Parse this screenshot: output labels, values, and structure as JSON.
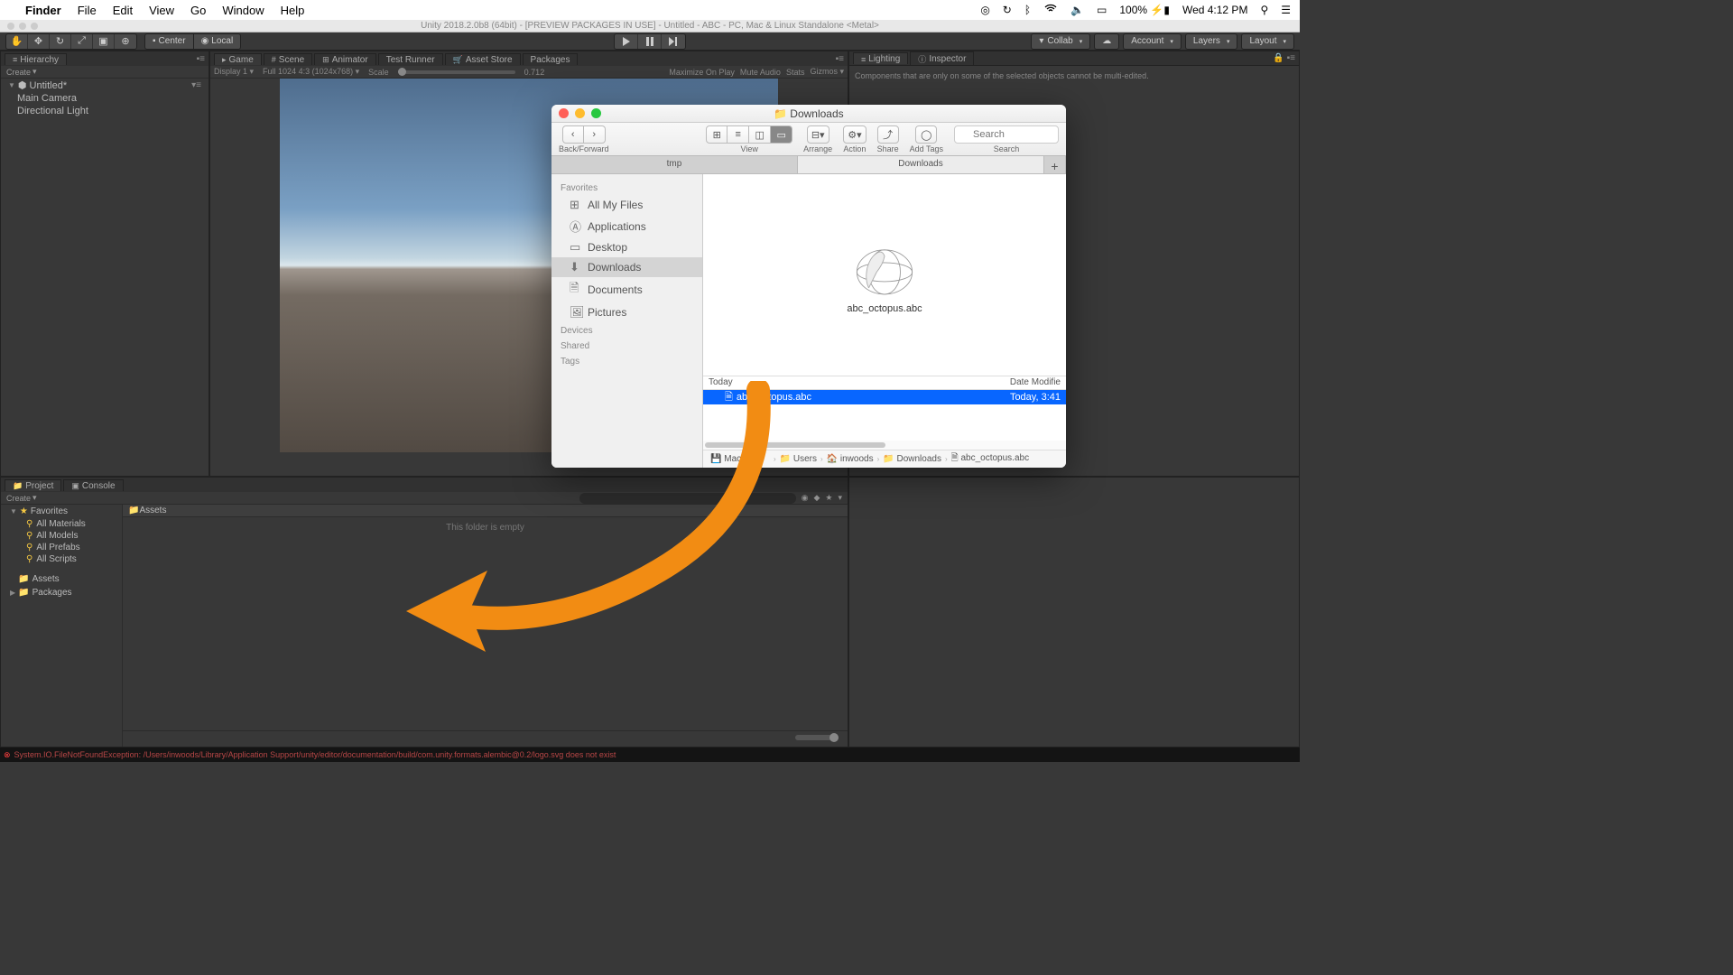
{
  "mac_menubar": {
    "app": "Finder",
    "items": [
      "File",
      "Edit",
      "View",
      "Go",
      "Window",
      "Help"
    ],
    "battery": "100%",
    "clock": "Wed 4:12 PM"
  },
  "unity_title": "Unity 2018.2.0b8 (64bit) - [PREVIEW PACKAGES IN USE] - Untitled - ABC - PC, Mac & Linux Standalone <Metal>",
  "toolbar": {
    "pivot1": "Center",
    "pivot2": "Local",
    "collab": "Collab",
    "account": "Account",
    "layers": "Layers",
    "layout": "Layout"
  },
  "hierarchy": {
    "tab": "Hierarchy",
    "create": "Create",
    "scene": "Untitled*",
    "items": [
      "Main Camera",
      "Directional Light"
    ]
  },
  "center_tabs": [
    "Game",
    "Scene",
    "Animator",
    "Test Runner",
    "Asset Store",
    "Packages"
  ],
  "game_bar": {
    "display": "Display 1",
    "aspect": "Full 1024 4:3 (1024x768)",
    "scale_label": "Scale",
    "scale_value": "0.712",
    "right": [
      "Maximize On Play",
      "Mute Audio",
      "Stats",
      "Gizmos"
    ]
  },
  "lighting": {
    "tab": "Lighting"
  },
  "inspector": {
    "tab": "Inspector",
    "message": "Components that are only on some of the selected objects cannot be multi-edited."
  },
  "project": {
    "tab": "Project",
    "console_tab": "Console",
    "create": "Create",
    "favorites": "Favorites",
    "fav_items": [
      "All Materials",
      "All Models",
      "All Prefabs",
      "All Scripts"
    ],
    "assets": "Assets",
    "packages": "Packages",
    "path": "Assets",
    "empty": "This folder is empty"
  },
  "error": "System.IO.FileNotFoundException: /Users/inwoods/Library/Application Support/unity/editor/documentation/build/com.unity.formats.alembic@0.2/logo.svg does not exist",
  "finder": {
    "title": "Downloads",
    "toolbar": {
      "back": "Back/Forward",
      "view": "View",
      "arrange": "Arrange",
      "action": "Action",
      "share": "Share",
      "tags": "Add Tags",
      "search": "Search",
      "search_placeholder": "Search"
    },
    "tabs": [
      "tmp",
      "Downloads"
    ],
    "sidebar": {
      "favorites": "Favorites",
      "items": [
        "All My Files",
        "Applications",
        "Desktop",
        "Downloads",
        "Documents",
        "Pictures"
      ],
      "devices": "Devices",
      "shared": "Shared",
      "tags": "Tags"
    },
    "preview_name": "abc_octopus.abc",
    "list": {
      "col_today": "Today",
      "col_date": "Date Modifie",
      "file_name": "abc_octopus.abc",
      "file_date": "Today, 3:41"
    },
    "path": [
      "Mac",
      "sh HD",
      "Users",
      "inwoods",
      "Downloads",
      "abc_octopus.abc"
    ]
  }
}
